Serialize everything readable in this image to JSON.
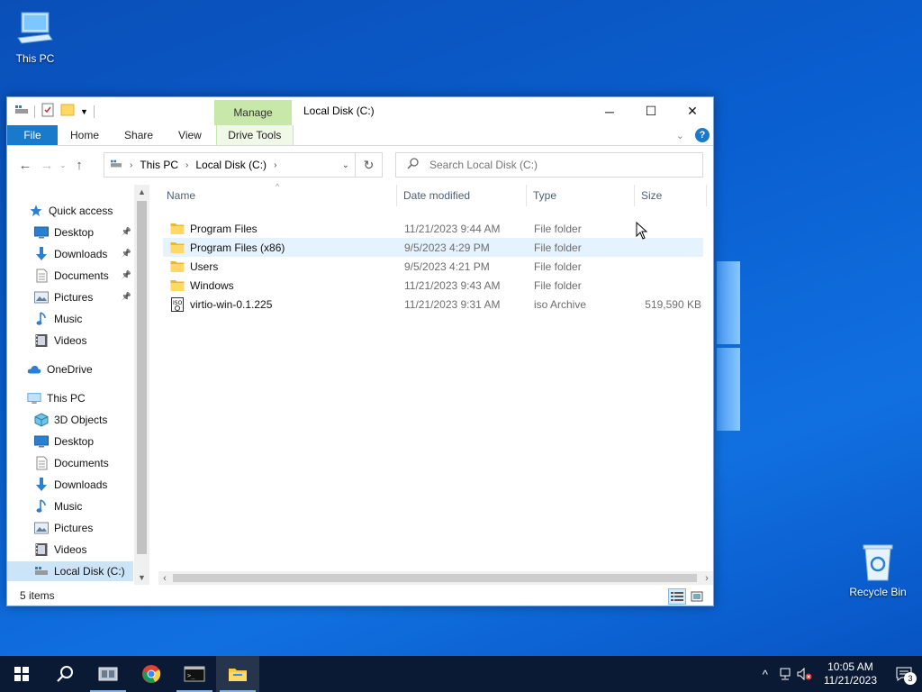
{
  "desktop": {
    "icons": [
      {
        "label": "This PC"
      },
      {
        "label": "Recycle Bin"
      }
    ]
  },
  "window": {
    "title": "Local Disk (C:)",
    "manage_tab": "Manage",
    "controls": {
      "minimize": "─",
      "maximize": "☐",
      "close": "✕"
    }
  },
  "ribbon": {
    "tabs": [
      {
        "label": "File"
      },
      {
        "label": "Home"
      },
      {
        "label": "Share"
      },
      {
        "label": "View"
      },
      {
        "label": "Drive Tools"
      }
    ]
  },
  "address": {
    "crumbs": [
      {
        "label": "This PC"
      },
      {
        "label": "Local Disk (C:)"
      }
    ]
  },
  "search": {
    "placeholder": "Search Local Disk (C:)"
  },
  "nav": {
    "items": [
      {
        "label": "Quick access",
        "icon": "star-icon"
      },
      {
        "label": "Desktop",
        "icon": "desktop-icon",
        "pinned": true
      },
      {
        "label": "Downloads",
        "icon": "download-icon",
        "pinned": true
      },
      {
        "label": "Documents",
        "icon": "document-icon",
        "pinned": true
      },
      {
        "label": "Pictures",
        "icon": "pictures-icon",
        "pinned": true
      },
      {
        "label": "Music",
        "icon": "music-icon"
      },
      {
        "label": "Videos",
        "icon": "video-icon"
      },
      {
        "label": "OneDrive",
        "icon": "cloud-icon"
      },
      {
        "label": "This PC",
        "icon": "computer-icon"
      },
      {
        "label": "3D Objects",
        "icon": "cube-icon"
      },
      {
        "label": "Desktop",
        "icon": "desktop-icon"
      },
      {
        "label": "Documents",
        "icon": "document-icon"
      },
      {
        "label": "Downloads",
        "icon": "download-icon"
      },
      {
        "label": "Music",
        "icon": "music-icon"
      },
      {
        "label": "Pictures",
        "icon": "pictures-icon"
      },
      {
        "label": "Videos",
        "icon": "video-icon"
      },
      {
        "label": "Local Disk (C:)",
        "icon": "drive-icon",
        "selected": true
      }
    ]
  },
  "columns": {
    "name": "Name",
    "date": "Date modified",
    "type": "Type",
    "size": "Size"
  },
  "files": [
    {
      "name": "Program Files",
      "date": "11/21/2023 9:44 AM",
      "type": "File folder",
      "size": "",
      "icon": "folder-icon"
    },
    {
      "name": "Program Files (x86)",
      "date": "9/5/2023 4:29 PM",
      "type": "File folder",
      "size": "",
      "icon": "folder-icon",
      "hover": true
    },
    {
      "name": "Users",
      "date": "9/5/2023 4:21 PM",
      "type": "File folder",
      "size": "",
      "icon": "folder-icon"
    },
    {
      "name": "Windows",
      "date": "11/21/2023 9:43 AM",
      "type": "File folder",
      "size": "",
      "icon": "folder-icon"
    },
    {
      "name": "virtio-win-0.1.225",
      "date": "11/21/2023 9:31 AM",
      "type": "iso Archive",
      "size": "519,590 KB",
      "icon": "iso-icon"
    }
  ],
  "status": {
    "count": "5 items"
  },
  "taskbar": {
    "clock_time": "10:05 AM",
    "clock_date": "11/21/2023",
    "notification_count": "3"
  },
  "colors": {
    "accent": "#1979ca",
    "manage": "#c7e8a8",
    "taskbar": "#0a1a34",
    "selection": "#cce4f7"
  }
}
